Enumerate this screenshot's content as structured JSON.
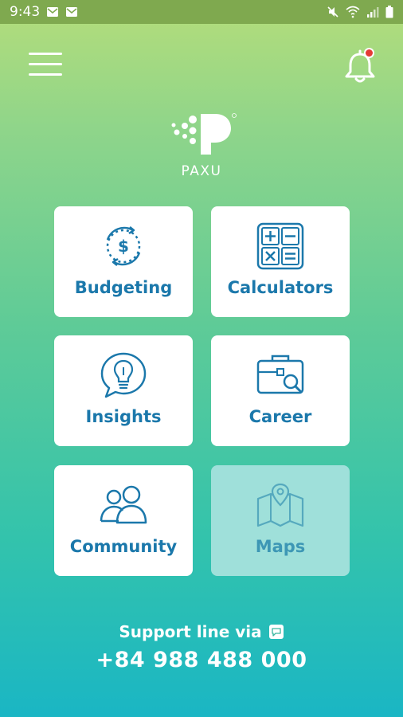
{
  "status_bar": {
    "time": "9:43",
    "left_icons": [
      "mail-icon",
      "mail-icon"
    ],
    "right_icons": [
      "mute-icon",
      "wifi-icon",
      "signal-icon",
      "battery-icon"
    ]
  },
  "header": {
    "menu_icon": "hamburger-menu-icon",
    "notification_icon": "bell-icon",
    "notification_dot_color": "#e53935"
  },
  "brand": {
    "name": "PAXU"
  },
  "tiles": [
    {
      "label": "Budgeting",
      "icon": "budget-cycle-icon",
      "enabled": true
    },
    {
      "label": "Calculators",
      "icon": "calculator-icon",
      "enabled": true
    },
    {
      "label": "Insights",
      "icon": "lightbulb-chat-icon",
      "enabled": true
    },
    {
      "label": "Career",
      "icon": "briefcase-search-icon",
      "enabled": true
    },
    {
      "label": "Community",
      "icon": "people-icon",
      "enabled": true
    },
    {
      "label": "Maps",
      "icon": "map-pin-icon",
      "enabled": false
    }
  ],
  "support": {
    "text": "Support line via",
    "icon": "chat-app-icon",
    "phone": "+84 988 488 000"
  },
  "colors": {
    "accent": "#1b78ab",
    "tile_bg": "#ffffff",
    "tile_disabled_bg": "#9fe0da"
  }
}
